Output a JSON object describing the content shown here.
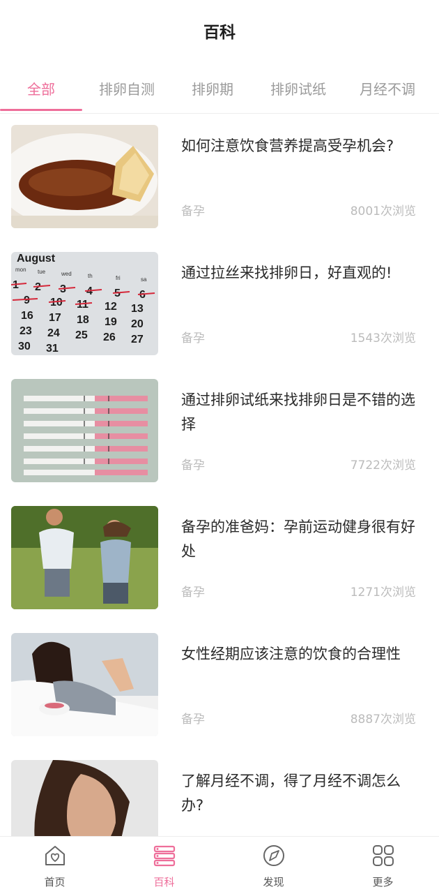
{
  "header": {
    "title": "百科"
  },
  "tabs": [
    {
      "label": "全部",
      "active": true
    },
    {
      "label": "排卵自测",
      "active": false
    },
    {
      "label": "排卵期",
      "active": false
    },
    {
      "label": "排卵试纸",
      "active": false
    },
    {
      "label": "月经不调",
      "active": false
    }
  ],
  "articles": [
    {
      "title": "如何注意饮食营养提高受孕机会?",
      "category": "备孕",
      "views": "8001次浏览"
    },
    {
      "title": "通过拉丝来找排卵日，好直观的!",
      "category": "备孕",
      "views": "1543次浏览"
    },
    {
      "title": "通过排卵试纸来找排卵日是不错的选择",
      "category": "备孕",
      "views": "7722次浏览"
    },
    {
      "title": "备孕的准爸妈：孕前运动健身很有好处",
      "category": "备孕",
      "views": "1271次浏览"
    },
    {
      "title": "女性经期应该注意的饮食的合理性",
      "category": "备孕",
      "views": "8887次浏览"
    },
    {
      "title": "了解月经不调，得了月经不调怎么办?",
      "category": "",
      "views": ""
    }
  ],
  "thumb_calendar": {
    "month": "August",
    "weekdays": [
      "mon",
      "tue",
      "wed",
      "th",
      "fri",
      "sa"
    ],
    "rows": [
      [
        "1",
        "2",
        "3",
        "4",
        "5",
        "6"
      ],
      [
        "9",
        "10",
        "11",
        "12",
        "13"
      ],
      [
        "16",
        "17",
        "18",
        "19",
        "20"
      ],
      [
        "23",
        "24",
        "25",
        "26",
        "27"
      ],
      [
        "30",
        "31"
      ]
    ]
  },
  "bottom_nav": [
    {
      "label": "首页",
      "icon": "home-heart-icon",
      "active": false
    },
    {
      "label": "百科",
      "icon": "book-stack-icon",
      "active": true
    },
    {
      "label": "发现",
      "icon": "compass-icon",
      "active": false
    },
    {
      "label": "更多",
      "icon": "grid-icon",
      "active": false
    }
  ],
  "colors": {
    "accent": "#ee6e9a",
    "muted": "#bbbbbb",
    "tab_inactive": "#9a9a9a"
  }
}
